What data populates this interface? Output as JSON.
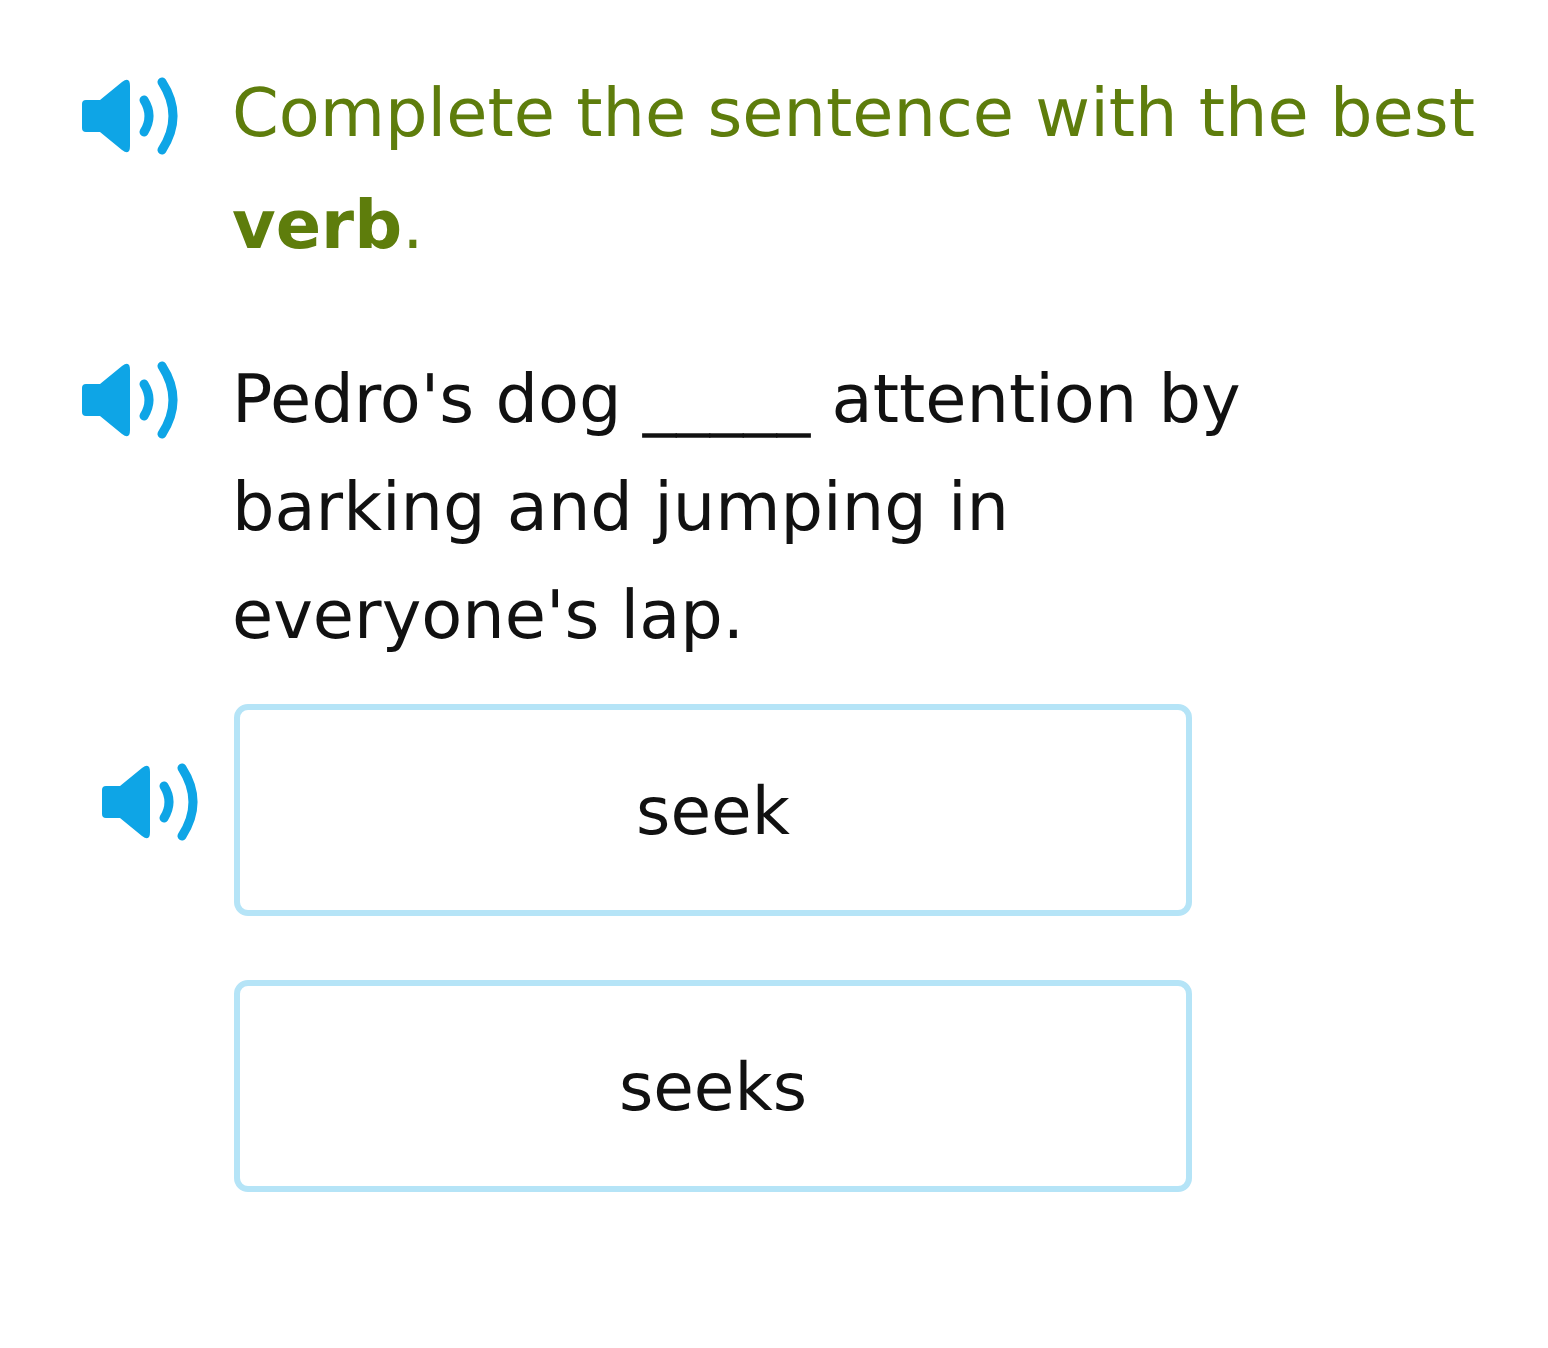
{
  "instruction": {
    "text": "Complete the sentence with the best **verb**.",
    "audio": true
  },
  "question": {
    "text": "Pedro's dog _____ attention by barking and jumping in everyone's lap.",
    "audio": true
  },
  "choices": [
    {
      "label": "seek",
      "selected": false,
      "audio": true
    },
    {
      "label": "seeks",
      "selected": false,
      "audio": false
    }
  ]
}
